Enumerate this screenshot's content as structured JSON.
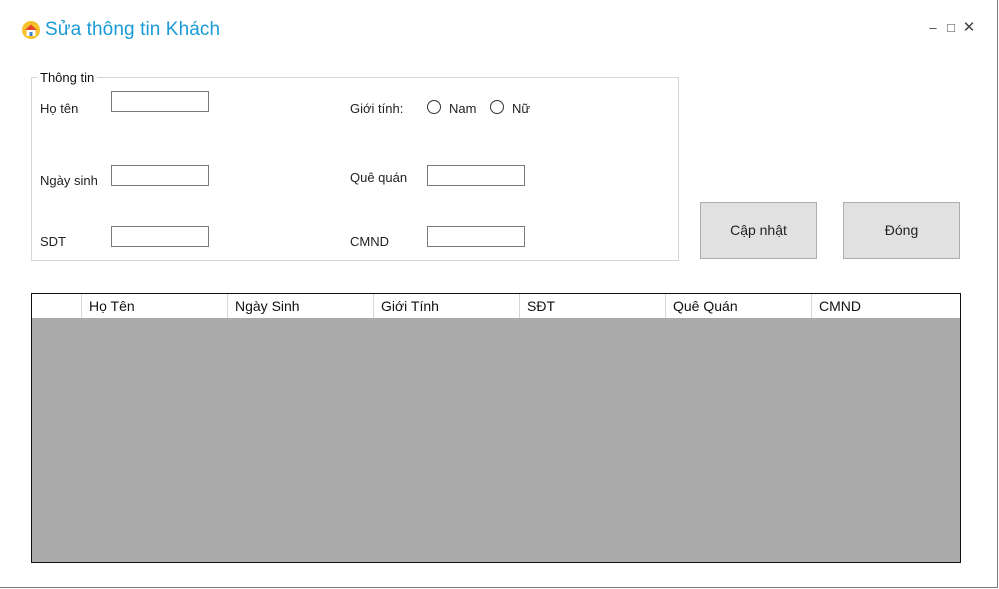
{
  "window": {
    "title": "Sửa thông tin Khách",
    "controls": {
      "minimize": "–",
      "maximize": "□",
      "close": "✕"
    }
  },
  "group": {
    "legend": "Thông tin",
    "fields": {
      "ho_ten": {
        "label": "Họ tên",
        "value": ""
      },
      "ngay_sinh": {
        "label": "Ngày sinh",
        "value": ""
      },
      "sdt": {
        "label": "SDT",
        "value": ""
      },
      "gioi_tinh": {
        "label": "Giới tính:",
        "options": [
          "Nam",
          "Nữ"
        ],
        "selected": null
      },
      "que_quan": {
        "label": "Quê quán",
        "value": ""
      },
      "cmnd": {
        "label": "CMND",
        "value": ""
      }
    }
  },
  "buttons": {
    "update": "Cập nhật",
    "close": "Đóng"
  },
  "table": {
    "columns": [
      "Họ Tên",
      "Ngày Sinh",
      "Giới Tính",
      "SĐT",
      "Quê Quán",
      "CMND"
    ],
    "rows": []
  },
  "colors": {
    "title": "#1a9ad6",
    "grid_background": "#ababab",
    "button": "#e1e1e1"
  }
}
